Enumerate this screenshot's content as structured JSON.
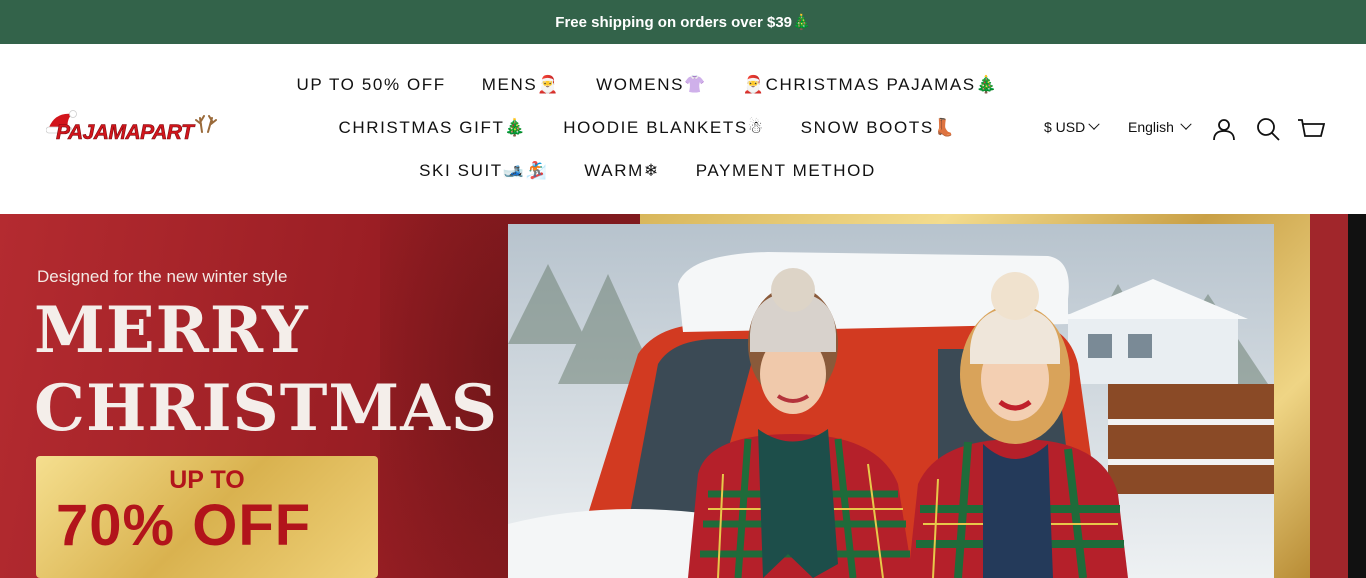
{
  "announcement": {
    "text": "Free shipping on orders over $39🎄"
  },
  "brand": {
    "logo_text": "PAJAMAPART"
  },
  "nav": {
    "row1": [
      "UP TO 50% OFF",
      "MENS🎅",
      "WOMENS👚",
      "🎅CHRISTMAS PAJAMAS🎄"
    ],
    "row2": [
      "CHRISTMAS GIFT🎄",
      "HOODIE BLANKETS☃",
      "SNOW BOOTS👢"
    ],
    "row3": [
      "SKI SUIT🎿🏂",
      "WARM❄",
      "PAYMENT METHOD"
    ]
  },
  "utility": {
    "currency": "$ USD",
    "language": "English"
  },
  "icons": [
    "account-icon",
    "search-icon",
    "cart-icon"
  ],
  "hero": {
    "tagline": "Designed for the new winter style",
    "headline_line1": "MERRY",
    "headline_line2": "CHRISTMAS",
    "coupon_line1": "UP TO",
    "coupon_line2": "70% OFF"
  },
  "colors": {
    "announcement_bg": "#33634a",
    "brand_red": "#d2151c",
    "hero_red": "#9c2226",
    "gold": "#d9b24f"
  }
}
